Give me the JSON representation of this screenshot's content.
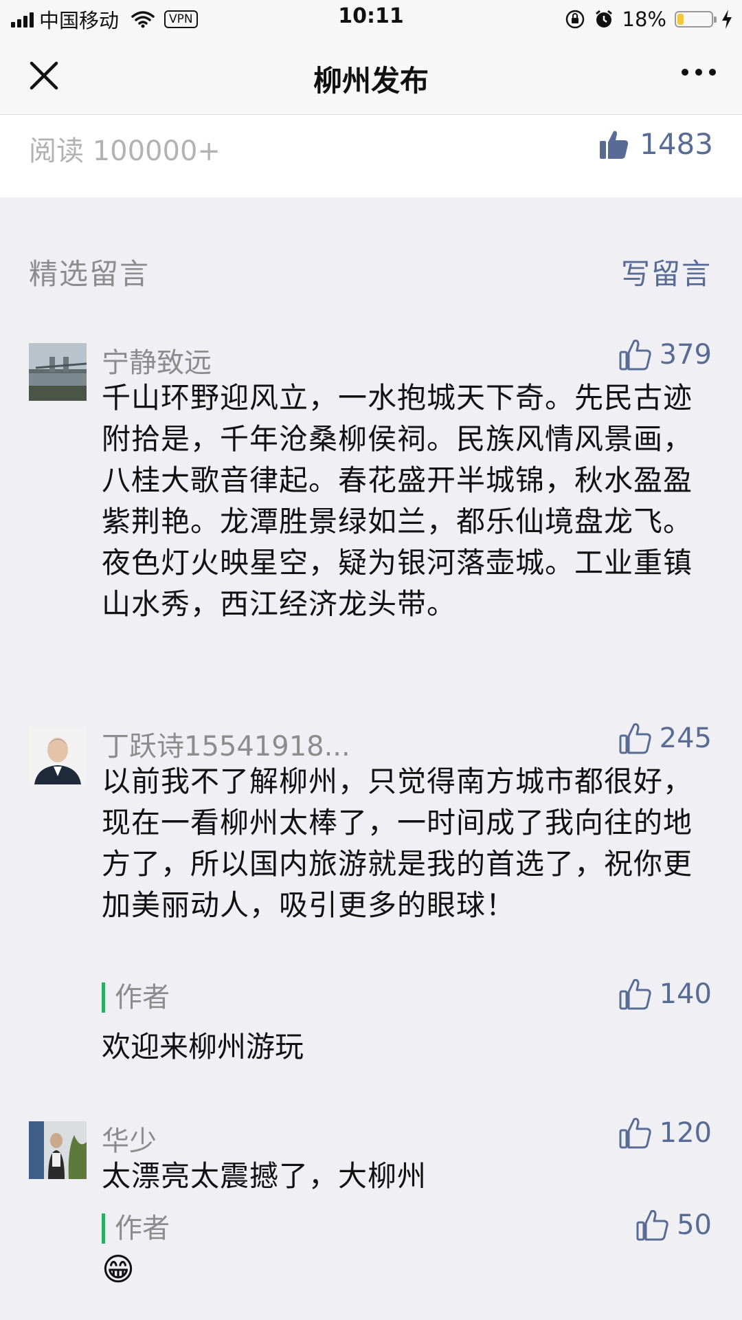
{
  "status_bar": {
    "carrier": "中国移动",
    "vpn": "VPN",
    "time": "10:11",
    "battery_percent": "18%",
    "battery_level": 0.18
  },
  "nav": {
    "title": "柳州发布"
  },
  "article_stats": {
    "reads": "阅读 100000+",
    "likes": "1483"
  },
  "comments_section": {
    "title": "精选留言",
    "write_label": "写留言"
  },
  "comments": [
    {
      "name": "宁静致远",
      "likes": "379",
      "text": "千山环野迎风立，一水抱城天下奇。先民古迹附拾是，千年沧桑柳侯祠。民族风情风景画，八桂大歌音律起。春花盛开半城锦，秋水盈盈紫荆艳。龙潭胜景绿如兰，都乐仙境盘龙飞。夜色灯火映星空，疑为银河落壶城。工业重镇山水秀，西江经济龙头带。"
    },
    {
      "name": "丁跃诗15541918...",
      "likes": "245",
      "text": "以前我不了解柳州，只觉得南方城市都很好，现在一看柳州太棒了，一时间成了我向往的地方了，所以国内旅游就是我的首选了，祝你更加美丽动人，吸引更多的眼球！",
      "reply": {
        "label": "作者",
        "likes": "140",
        "text": "欢迎来柳州游玩"
      }
    },
    {
      "name": "华少",
      "likes": "120",
      "text": "太漂亮太震撼了，大柳州",
      "reply": {
        "label": "作者",
        "likes": "50",
        "text": "😁"
      }
    }
  ]
}
